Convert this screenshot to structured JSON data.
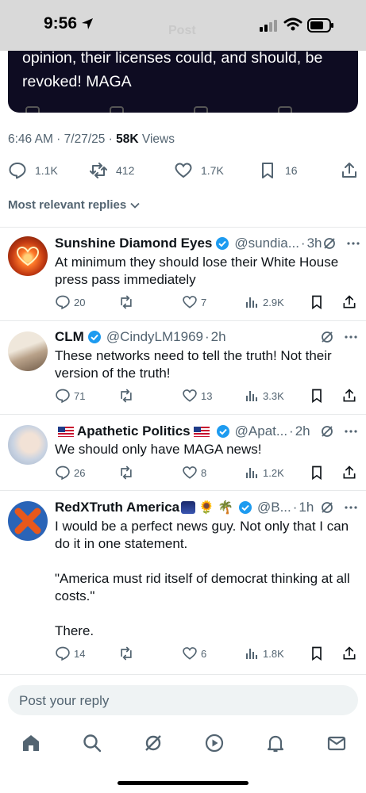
{
  "status_bar": {
    "time": "9:56",
    "ghost_title": "Post"
  },
  "quoted_post": {
    "text": "opinion, their licenses could, and should, be revoked! MAGA"
  },
  "post_meta": {
    "time": "6:46 AM",
    "sep1": " · ",
    "date": "7/27/25",
    "sep2": " · ",
    "views_count": "58K",
    "views_label": " Views"
  },
  "post_stats": {
    "replies": "1.1K",
    "reposts": "412",
    "likes": "1.7K",
    "bookmarks": "16"
  },
  "sort_label": "Most relevant replies",
  "replies": [
    {
      "name": "Sunshine Diamond Eyes",
      "handle": "@sundia...",
      "time": "3h",
      "text": "At minimum they should lose their White House press pass immediately",
      "replies": "20",
      "likes": "7",
      "views": "2.9K"
    },
    {
      "name": "CLM",
      "handle": "@CindyLM1969",
      "time": "2h",
      "text": "These networks need to tell the truth! Not their version of the truth!",
      "replies": "71",
      "likes": "13",
      "views": "3.3K"
    },
    {
      "name": "Apathetic Politics",
      "handle": "@Apat...",
      "time": "2h",
      "text": "We should only have MAGA news!",
      "replies": "26",
      "likes": "8",
      "views": "1.2K"
    },
    {
      "name": "RedXTruth America",
      "handle": "@B...",
      "time": "1h",
      "text": "I would be a perfect news guy. Not only that I can do it in one statement.\n\n\"America must rid itself of democrat thinking at all costs.\"\n\nThere.",
      "replies": "14",
      "likes": "6",
      "views": "1.8K"
    }
  ],
  "composer": {
    "placeholder": "Post your reply"
  },
  "nav": [
    "home-icon",
    "search-icon",
    "grok-icon",
    "video-icon",
    "notifications-icon",
    "messages-icon"
  ],
  "colors": {
    "verified": "#1d9bf0",
    "text": "#0f1419",
    "muted": "#536471",
    "quote_bg": "#0e0c22"
  }
}
